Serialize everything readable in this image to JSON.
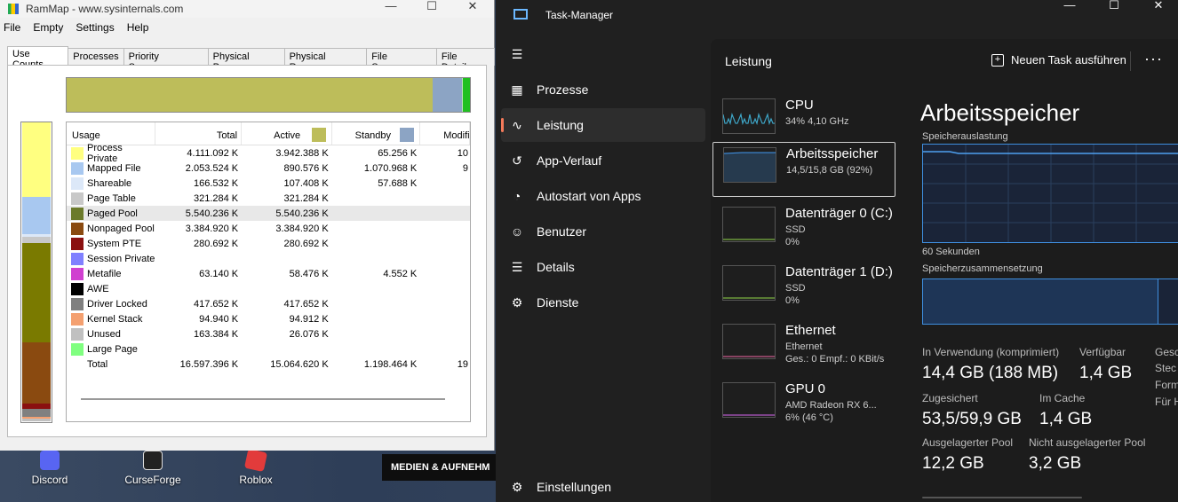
{
  "desktop": {
    "icons": [
      {
        "label": "Discord",
        "color": "#5865f2"
      },
      {
        "label": "CurseForge",
        "color": "#222222"
      },
      {
        "label": "Roblox",
        "color": "#e23b3b"
      }
    ],
    "media_bar": "MEDIEN & AUFNEHM"
  },
  "rammap": {
    "title": "RamMap - www.sysinternals.com",
    "menus": [
      "File",
      "Empty",
      "Settings",
      "Help"
    ],
    "tabs": [
      "Use Counts",
      "Processes",
      "Priority Summary",
      "Physical Pages",
      "Physical Ranges",
      "File Summary",
      "File Details"
    ],
    "columns": [
      "Usage",
      "Total",
      "Active",
      "Standby",
      "Modified"
    ],
    "active_color": "#bdbd5a",
    "standby_color": "#8ca4c4",
    "rows": [
      {
        "usage": "Process Private",
        "total": "4.111.092 K",
        "active": "3.942.388 K",
        "standby": "65.256 K",
        "modified": "10",
        "color": "#ffff80"
      },
      {
        "usage": "Mapped File",
        "total": "2.053.524 K",
        "active": "890.576 K",
        "standby": "1.070.968 K",
        "modified": "9",
        "color": "#a8c8f0"
      },
      {
        "usage": "Shareable",
        "total": "166.532 K",
        "active": "107.408 K",
        "standby": "57.688 K",
        "modified": "",
        "color": "#dce8f8"
      },
      {
        "usage": "Page Table",
        "total": "321.284 K",
        "active": "321.284 K",
        "standby": "",
        "modified": "",
        "color": "#c8c8c8"
      },
      {
        "usage": "Paged Pool",
        "total": "5.540.236 K",
        "active": "5.540.236 K",
        "standby": "",
        "modified": "",
        "color": "#6b7a2a"
      },
      {
        "usage": "Nonpaged Pool",
        "total": "3.384.920 K",
        "active": "3.384.920 K",
        "standby": "",
        "modified": "",
        "color": "#8a4a10"
      },
      {
        "usage": "System PTE",
        "total": "280.692 K",
        "active": "280.692 K",
        "standby": "",
        "modified": "",
        "color": "#8a1010"
      },
      {
        "usage": "Session Private",
        "total": "",
        "active": "",
        "standby": "",
        "modified": "",
        "color": "#8080ff"
      },
      {
        "usage": "Metafile",
        "total": "63.140 K",
        "active": "58.476 K",
        "standby": "4.552 K",
        "modified": "",
        "color": "#d040d0"
      },
      {
        "usage": "AWE",
        "total": "",
        "active": "",
        "standby": "",
        "modified": "",
        "color": "#000000"
      },
      {
        "usage": "Driver Locked",
        "total": "417.652 K",
        "active": "417.652 K",
        "standby": "",
        "modified": "",
        "color": "#808080"
      },
      {
        "usage": "Kernel Stack",
        "total": "94.940 K",
        "active": "94.912 K",
        "standby": "",
        "modified": "",
        "color": "#f4a070"
      },
      {
        "usage": "Unused",
        "total": "163.384 K",
        "active": "26.076 K",
        "standby": "",
        "modified": "",
        "color": "#c0c0c0"
      },
      {
        "usage": "Large Page",
        "total": "",
        "active": "",
        "standby": "",
        "modified": "",
        "color": "#80ff80"
      },
      {
        "usage": "Total",
        "total": "16.597.396 K",
        "active": "15.064.620 K",
        "standby": "1.198.464 K",
        "modified": "19",
        "color": ""
      }
    ],
    "left_bar": [
      {
        "color": "#ffff80",
        "share": 24.8
      },
      {
        "color": "#a8c8f0",
        "share": 12.4
      },
      {
        "color": "#dce8f8",
        "share": 1.0
      },
      {
        "color": "#c8c8c8",
        "share": 1.9
      },
      {
        "color": "#7a7a00",
        "share": 33.4
      },
      {
        "color": "#8a4a10",
        "share": 20.4
      },
      {
        "color": "#8a1010",
        "share": 1.7
      },
      {
        "color": "#808080",
        "share": 2.5
      },
      {
        "color": "#f4a070",
        "share": 0.6
      },
      {
        "color": "#c0c0c0",
        "share": 1.0
      }
    ],
    "top_bar": [
      {
        "color": "#bdbd5a",
        "share": 90.8
      },
      {
        "color": "#8ca4c4",
        "share": 7.2
      },
      {
        "color": "#c0e0c0",
        "share": 0.2
      },
      {
        "color": "#20c020",
        "share": 1.8
      }
    ]
  },
  "taskmanager": {
    "title": "Task-Manager",
    "nav": [
      {
        "label": "Prozesse",
        "icon": "grid-icon"
      },
      {
        "label": "Leistung",
        "icon": "pulse-icon",
        "active": true
      },
      {
        "label": "App-Verlauf",
        "icon": "history-icon"
      },
      {
        "label": "Autostart von Apps",
        "icon": "gauge-icon"
      },
      {
        "label": "Benutzer",
        "icon": "users-icon"
      },
      {
        "label": "Details",
        "icon": "list-icon"
      },
      {
        "label": "Dienste",
        "icon": "puzzle-icon"
      }
    ],
    "settings": "Einstellungen",
    "header": {
      "title": "Leistung",
      "new_task": "Neuen Task ausführen",
      "more": "···"
    },
    "perf_items": [
      {
        "name": "CPU",
        "sub1": "34% 4,10 GHz",
        "sub2": "",
        "graph": "#3ea6c8",
        "usage": 0.34
      },
      {
        "name": "Arbeitsspeicher",
        "sub1": "14,5/15,8 GB (92%)",
        "sub2": "",
        "graph": "#3f8ede",
        "usage": 0.92,
        "active": true
      },
      {
        "name": "Datenträger 0 (C:)",
        "sub1": "SSD",
        "sub2": "0%",
        "graph": "#7cb342",
        "usage": 0.0
      },
      {
        "name": "Datenträger 1 (D:)",
        "sub1": "SSD",
        "sub2": "0%",
        "graph": "#7cb342",
        "usage": 0.0
      },
      {
        "name": "Ethernet",
        "sub1": "Ethernet",
        "sub2": "Ges.: 0 Empf.: 0 KBit/s",
        "graph": "#c85a8a",
        "usage": 0.0
      },
      {
        "name": "GPU 0",
        "sub1": "AMD Radeon RX 6...",
        "sub2": "6% (46 °C)",
        "graph": "#b45ac8",
        "usage": 0.06
      }
    ],
    "memory": {
      "title": "Arbeitsspeicher",
      "usage_label": "Speicherauslastung",
      "time_label": "60 Sekunden",
      "composition_label": "Speicherzusammensetzung",
      "usage_fraction": 0.92,
      "stats": [
        {
          "label": "In Verwendung (komprimiert)",
          "value": "14,4 GB (188 MB)"
        },
        {
          "label": "Verfügbar",
          "value": "1,4 GB"
        },
        {
          "label": "Gesc",
          "value": ""
        },
        {
          "label": "Zugesichert",
          "value": "53,5/59,9 GB"
        },
        {
          "label": "Im Cache",
          "value": "1,4 GB"
        },
        {
          "label": "Ausgelagerter Pool",
          "value": "12,2 GB"
        },
        {
          "label": "Nicht ausgelagerter Pool",
          "value": "3,2 GB"
        }
      ],
      "side_labels": [
        "Stec",
        "Form",
        "Für H"
      ]
    }
  }
}
